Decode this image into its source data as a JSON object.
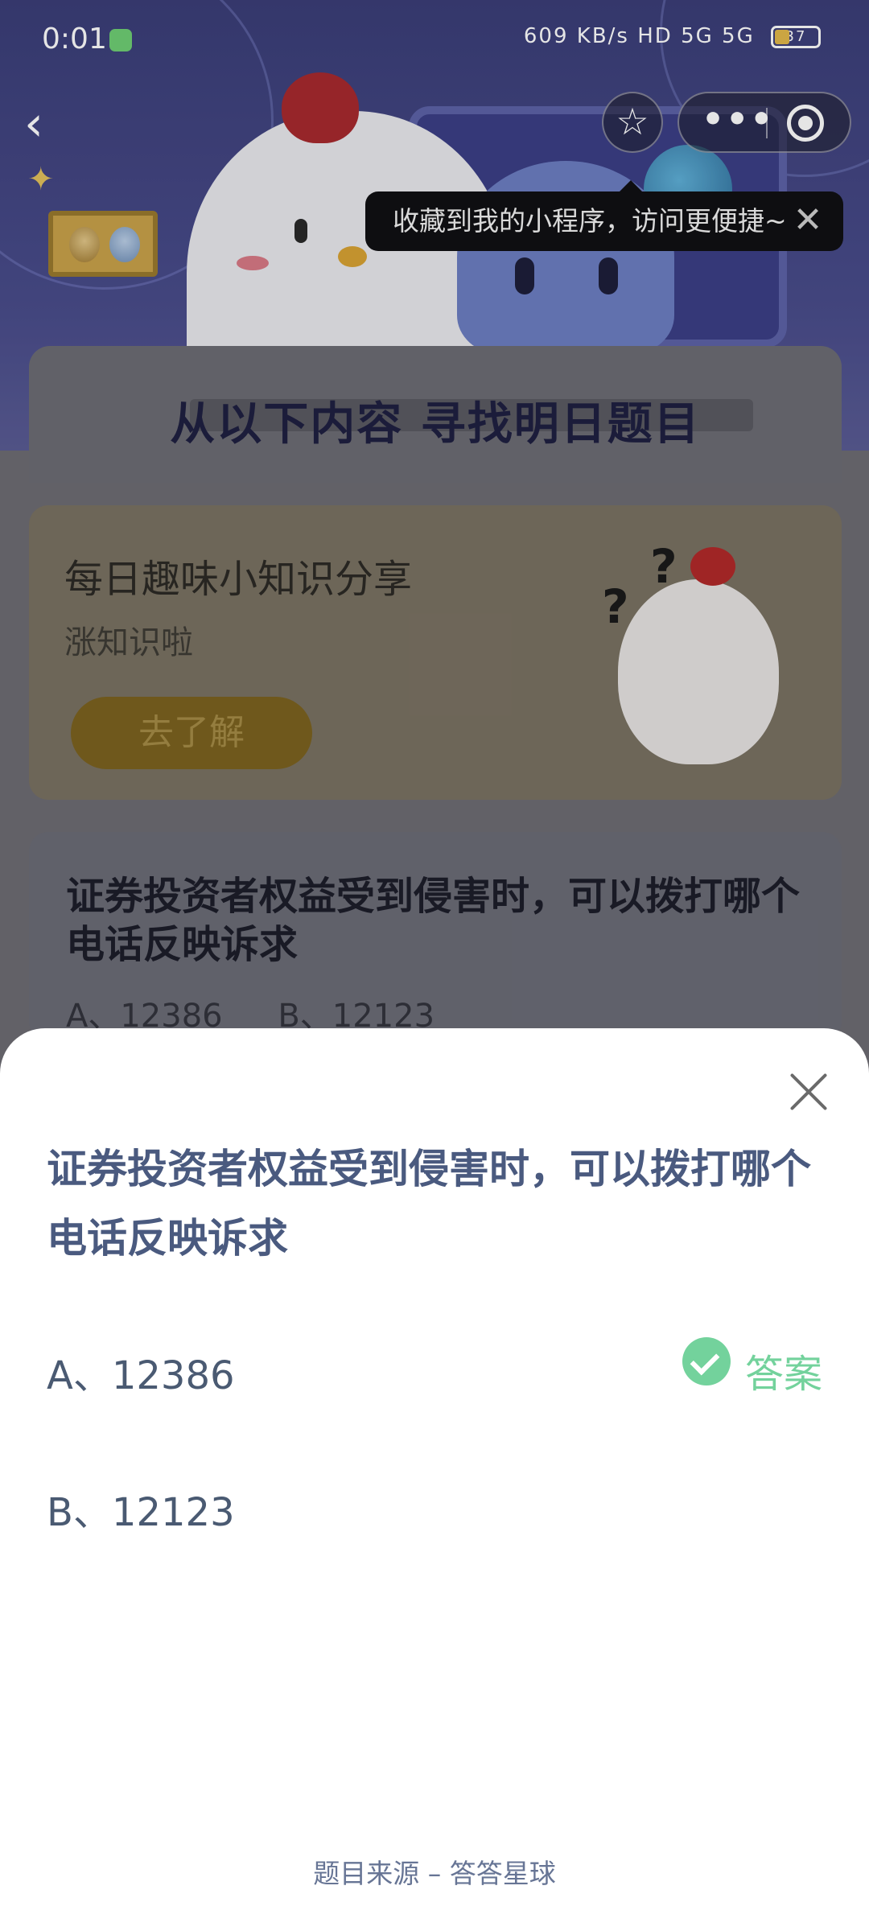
{
  "status_bar": {
    "time": "0:01",
    "net_speed": "609 KB/s",
    "network": "HD 5G 5G",
    "battery": "37"
  },
  "nav": {
    "back_icon": "chevron-left-icon",
    "favorite_icon": "star-icon",
    "more_icon": "more-dots-icon",
    "close_miniapp_icon": "target-circle-icon"
  },
  "tooltip": {
    "text": "收藏到我的小程序，访问更便捷~"
  },
  "background": {
    "section_title": "从以下内容 寻找明日题目",
    "share_card": {
      "title": "每日趣味小知识分享",
      "subtitle": "涨知识啦",
      "button": "去了解"
    },
    "question_card": {
      "question": "证券投资者权益受到侵害时，可以拨打哪个电话反映诉求",
      "options": [
        "A、12386",
        "B、12123"
      ]
    }
  },
  "sheet": {
    "question": "证券投资者权益受到侵害时，可以拨打哪个电话反映诉求",
    "options": [
      {
        "label": "A、12386",
        "is_answer": true,
        "answer_label": "答案"
      },
      {
        "label": "B、12123",
        "is_answer": false
      }
    ],
    "footer": "题目来源 – 答答星球"
  },
  "colors": {
    "answer_green": "#73d29c",
    "question_text": "#4a5a7f",
    "sheet_bg": "#ffffff"
  }
}
